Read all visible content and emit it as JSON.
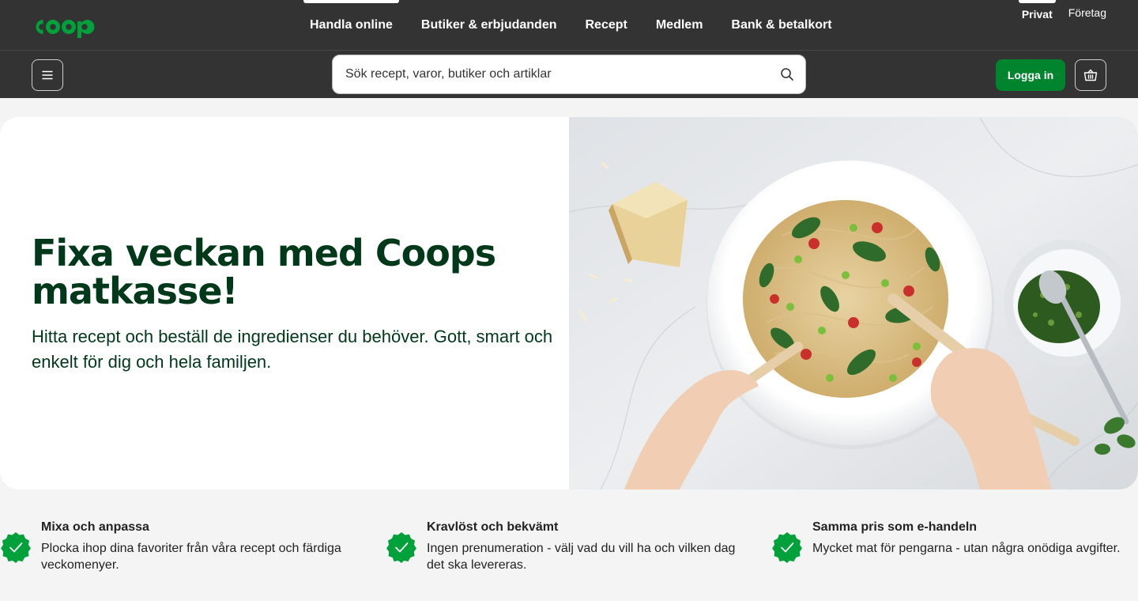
{
  "brand": {
    "logo_text": "coop",
    "green": "#00a13a",
    "dark_green": "#00391a",
    "button_green": "#00842e",
    "bar_color": "#333333"
  },
  "main_nav": [
    {
      "label": "Handla online",
      "active": true
    },
    {
      "label": "Butiker & erbjudanden",
      "active": false
    },
    {
      "label": "Recept",
      "active": false
    },
    {
      "label": "Medlem",
      "active": false
    },
    {
      "label": "Bank & betalkort",
      "active": false
    }
  ],
  "segment_nav": [
    {
      "label": "Privat",
      "active": true
    },
    {
      "label": "Företag",
      "active": false
    }
  ],
  "search": {
    "placeholder": "Sök recept, varor, butiker och artiklar",
    "icon": "search-icon"
  },
  "header_actions": {
    "menu_icon": "hamburger-icon",
    "login_label": "Logga in",
    "basket_icon": "basket-icon"
  },
  "hero": {
    "title": "Fixa veckan med Coops matkasse!",
    "subtitle": "Hitta recept och beställ de ingredienser du behöver. Gott, smart och enkelt för dig och hela familjen.",
    "image": "pasta-plate-photo"
  },
  "features": [
    {
      "title": "Mixa och anpassa",
      "description": "Plocka ihop dina favoriter från våra recept och färdiga veckomenyer.",
      "icon": "check-badge-icon"
    },
    {
      "title": "Kravlöst och bekvämt",
      "description": "Ingen prenumeration - välj vad du vill ha och vilken dag det ska levereras.",
      "icon": "check-badge-icon"
    },
    {
      "title": "Samma pris som e-handeln",
      "description": "Mycket mat för pengarna - utan några onödiga avgifter.",
      "icon": "check-badge-icon"
    }
  ]
}
